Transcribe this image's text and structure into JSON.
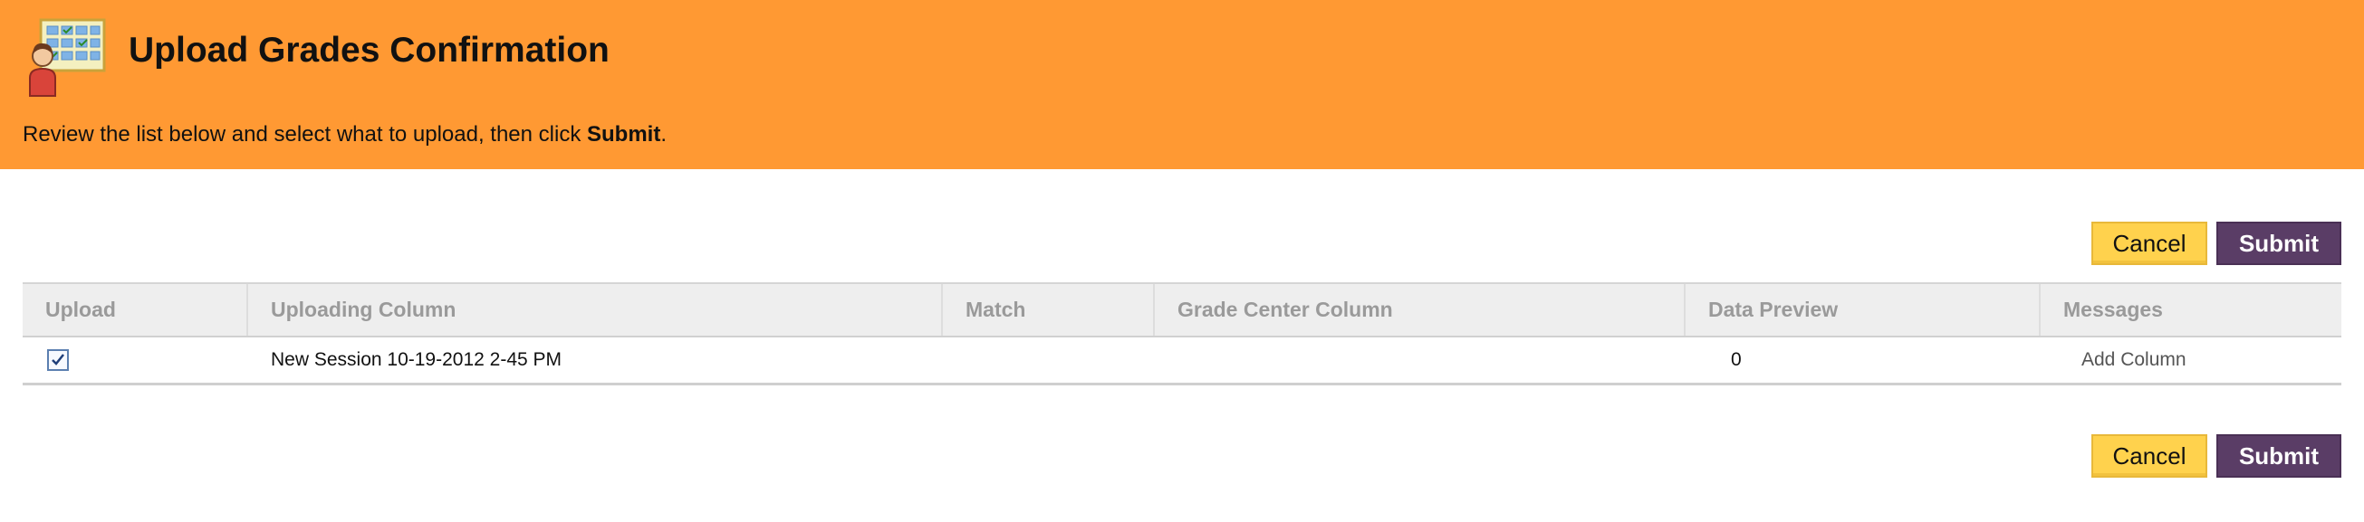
{
  "header": {
    "title": "Upload Grades Confirmation",
    "instructions_prefix": "Review the list below and select what to upload, then click ",
    "instructions_bold": "Submit",
    "instructions_suffix": ".",
    "icon": "gradebook-teacher-icon",
    "background_color": "#ff9933"
  },
  "actions": {
    "cancel_label": "Cancel",
    "submit_label": "Submit"
  },
  "table": {
    "columns": [
      "Upload",
      "Uploading Column",
      "Match",
      "Grade Center Column",
      "Data Preview",
      "Messages"
    ],
    "rows": [
      {
        "upload_checked": true,
        "uploading_column": "New Session 10-19-2012 2-45 PM",
        "match": "",
        "grade_center_column": "",
        "data_preview": "0",
        "messages": "Add Column"
      }
    ]
  }
}
